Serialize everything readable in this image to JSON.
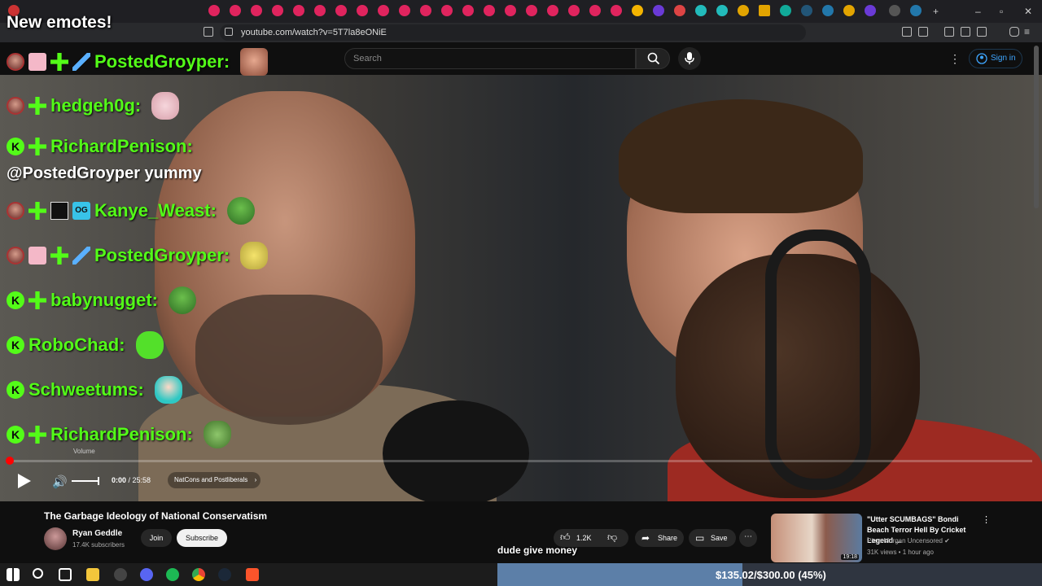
{
  "browser": {
    "url": "youtube.com/watch?v=5T7la8eONiE"
  },
  "youtube": {
    "search_placeholder": "Search",
    "sign_in": "Sign in",
    "video": {
      "title": "The Garbage Ideology of National Conservatism",
      "time_current": "0:00",
      "time_total": "25:58",
      "time_separator": " / ",
      "chapter": "NatCons and Postliberals",
      "volume_tooltip": "Volume",
      "progress_fraction": 0.0
    },
    "channel": {
      "name": "Ryan Geddle",
      "subscribers": "17.4K subscribers",
      "join": "Join",
      "subscribe": "Subscribe"
    },
    "actions": {
      "likes": "1.2K",
      "share": "Share",
      "save": "Save"
    },
    "recommended": {
      "title": "\"Utter SCUMBAGS\" Bondi Beach Terror Hell By Cricket Legend ...",
      "channel": "Piers Morgan Uncensored",
      "meta": "31K views • 1 hour ago",
      "duration": "19:18"
    }
  },
  "chat": {
    "header": "New emotes!",
    "messages": [
      {
        "user": "PostedGroyper:",
        "text": ""
      },
      {
        "user": "hedgeh0g:",
        "text": ""
      },
      {
        "user": "RichardPenison:",
        "text": "@PostedGroyper yummy"
      },
      {
        "user": "Kanye_Weast:",
        "text": ""
      },
      {
        "user": "PostedGroyper:",
        "text": ""
      },
      {
        "user": "babynugget:",
        "text": ""
      },
      {
        "user": "RoboChad:",
        "text": ""
      },
      {
        "user": "Schweetums:",
        "text": ""
      },
      {
        "user": "RichardPenison:",
        "text": ""
      }
    ]
  },
  "stream": {
    "caption": "dude give money",
    "goal_text": "$135.02/$300.00 (45%)",
    "goal_fraction": 0.45
  },
  "colors": {
    "kick_green": "#53fc18",
    "yt_red": "#ff0000",
    "link_blue": "#3ea6ff"
  }
}
